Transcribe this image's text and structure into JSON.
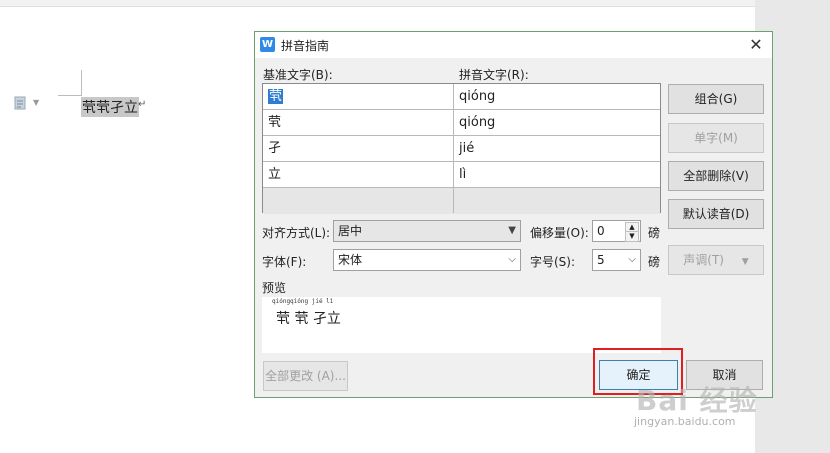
{
  "document": {
    "text": "茕茕孑立",
    "return_mark": "↵"
  },
  "dialog": {
    "title": "拼音指南",
    "close_label": "✕",
    "labels": {
      "base_text": "基准文字(B):",
      "pinyin_text": "拼音文字(R):",
      "align": "对齐方式(L):",
      "offset": "偏移量(O):",
      "font": "字体(F):",
      "size": "字号(S):",
      "preview": "预览",
      "unit_offset": "磅",
      "unit_size": "磅"
    },
    "rows": [
      {
        "base": "茕",
        "pinyin": "qióng"
      },
      {
        "base": "茕",
        "pinyin": "qióng"
      },
      {
        "base": "孑",
        "pinyin": "jié"
      },
      {
        "base": "立",
        "pinyin": "lì"
      }
    ],
    "align_value": "居中",
    "offset_value": "0",
    "font_value": "宋体",
    "size_value": "5",
    "preview_pinyin": "qióngqióng jié lì",
    "preview_text": "茕 茕 孑立",
    "buttons": {
      "group": "组合(G)",
      "single": "单字(M)",
      "clear_all": "全部删除(V)",
      "default_reading": "默认读音(D)",
      "tone": "声调(T)",
      "change_all": "全部更改 (A)...",
      "ok": "确定",
      "cancel": "取消"
    }
  },
  "watermark": {
    "logo": "Bai 经验",
    "url": "jingyan.baidu.com"
  },
  "colors": {
    "highlight": "#e02020",
    "selection": "#2f7dd1",
    "app_icon": "#2f8ae5"
  }
}
